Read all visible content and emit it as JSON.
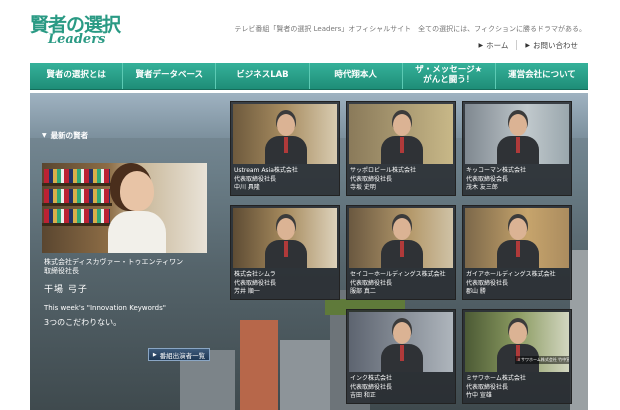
{
  "header": {
    "logo_text": "賢者の選択",
    "logo_sub": "Leaders",
    "tagline": "テレビ番組「賢者の選択 Leaders」オフィシャルサイト　全ての選択には、フィクションに勝るドラマがある。",
    "links": [
      {
        "label": "ホーム"
      },
      {
        "label": "お問い合わせ"
      }
    ]
  },
  "nav": [
    {
      "label": "賢者の選択とは"
    },
    {
      "label": "賢者データベース"
    },
    {
      "label": "ビジネスLAB"
    },
    {
      "label": "時代翔本人"
    },
    {
      "label": "ザ・メッセージ★\nがんと闘う！"
    },
    {
      "label": "運営会社について"
    }
  ],
  "featured": {
    "section_label": "最新の賢者",
    "company": "株式会社ディスカヴァー・トゥエンティワン",
    "title": "取締役社長",
    "name": "干場 弓子",
    "keywords_en": "This week's \"Innovation Keywords\"",
    "keywords_jp": "3つのこだわりない。",
    "list_button": "番組出演者一覧"
  },
  "cards": [
    {
      "company": "Ustream Asia株式会社",
      "title": "代表取締役社長",
      "name": "中川 具隆"
    },
    {
      "company": "サッポロビール株式会社",
      "title": "代表取締役社長",
      "name": "寺坂 史明"
    },
    {
      "company": "キッコーマン株式会社",
      "title": "代表取締役会長",
      "name": "茂木 友三郎"
    },
    {
      "company": "株式会社シムラ",
      "title": "代表取締役社長",
      "name": "芳井 順一"
    },
    {
      "company": "セイコーホールディングス株式会社",
      "title": "代表取締役社長",
      "name": "服部 真二"
    },
    {
      "company": "ガイアホールディングス株式会社",
      "title": "代表取締役社長",
      "name": "郡山 勝"
    },
    {
      "company": "インク株式会社",
      "title": "代表取締役社長",
      "name": "吉田 和正"
    },
    {
      "company": "ミサワホーム株式会社",
      "title": "代表取締役社長",
      "name": "竹中 宣雄",
      "caption": "ミサワホーム株式会社 竹中宣雄"
    }
  ]
}
